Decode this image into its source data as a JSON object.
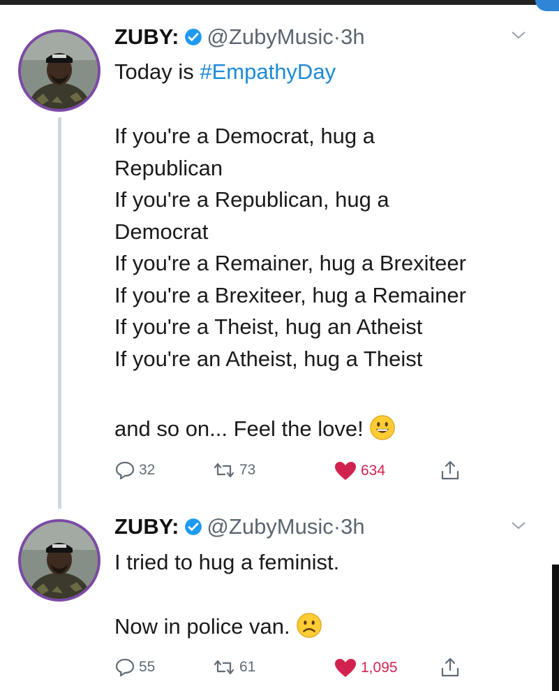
{
  "colors": {
    "link": "#1d8ad6",
    "verified": "#1d9bf0",
    "liked": "#d1224f",
    "avatar_ring": "#7c4aa6",
    "meta": "#5b6570"
  },
  "tweets": [
    {
      "name": "ZUBY:",
      "handle": "@ZubyMusic",
      "separator": "·",
      "time": "3h",
      "line1_prefix": "Today is",
      "hashtag": "#EmpathyDay",
      "lines": [
        "If you're a Democrat, hug a",
        "Republican",
        "If you're a Republican, hug a",
        "Democrat",
        "If you're a Remainer, hug a Brexiteer",
        "If you're a Brexiteer, hug a Remainer",
        "If you're a Theist, hug an Atheist",
        "If you're an Atheist, hug a Theist"
      ],
      "closing": "and so on... Feel the love!",
      "emoji": "grinning-face-emoji",
      "replies": "32",
      "retweets": "73",
      "likes": "634"
    },
    {
      "name": "ZUBY:",
      "handle": "@ZubyMusic",
      "separator": "·",
      "time": "3h",
      "line1": "I tried to hug a feminist.",
      "line2": "Now in police van.",
      "emoji": "frowning-face-emoji",
      "replies": "55",
      "retweets": "61",
      "likes": "1,095"
    }
  ]
}
